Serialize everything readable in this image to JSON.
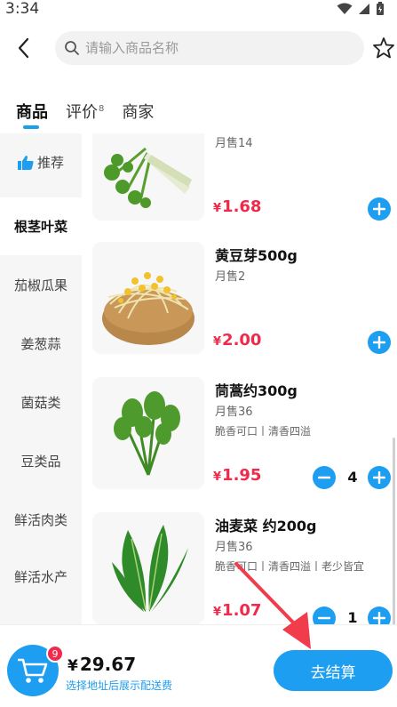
{
  "status_bar": {
    "time": "3:34"
  },
  "search": {
    "placeholder": "请输入商品名称"
  },
  "tabs": [
    {
      "label": "商品",
      "active": true
    },
    {
      "label": "评价",
      "count": "8"
    },
    {
      "label": "商家"
    }
  ],
  "sidebar": {
    "items": [
      {
        "label": "推荐",
        "icon": "thumbs-up-icon"
      },
      {
        "label": "根茎叶菜",
        "active": true
      },
      {
        "label": "茄椒瓜果"
      },
      {
        "label": "姜葱蒜"
      },
      {
        "label": "菌菇类"
      },
      {
        "label": "豆类品"
      },
      {
        "label": "鲜活肉类"
      },
      {
        "label": "鲜活水产"
      }
    ]
  },
  "products": [
    {
      "name": "",
      "sales": "月售14",
      "tags": "",
      "currency": "¥",
      "price": "1.68",
      "qty": ""
    },
    {
      "name": "黄豆芽500g",
      "sales": "月售2",
      "tags": "",
      "currency": "¥",
      "price": "2.00",
      "qty": ""
    },
    {
      "name": "茼蒿约300g",
      "sales": "月售36",
      "tags": "脆香可口丨清香四溢",
      "currency": "¥",
      "price": "1.95",
      "qty": "4"
    },
    {
      "name": "油麦菜 约200g",
      "sales": "月售36",
      "tags": "脆香可口丨清香四溢丨老少皆宜",
      "currency": "¥",
      "price": "1.07",
      "qty": "1"
    }
  ],
  "cart": {
    "badge": "9",
    "currency": "¥",
    "total": "29.67",
    "hint": "选择地址后展示配送费",
    "checkout_label": "去结算"
  },
  "colors": {
    "accent": "#1e9ef0",
    "price": "#ef2a4a",
    "annotation": "#f03c4b"
  }
}
